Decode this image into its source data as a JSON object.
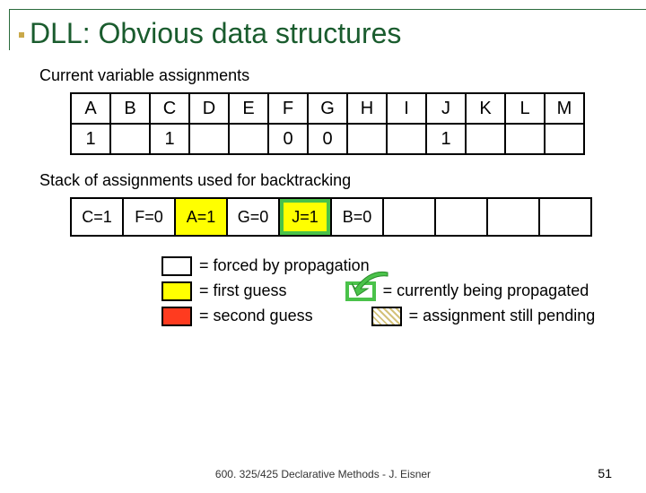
{
  "title": "DLL: Obvious data structures",
  "section1": "Current variable assignments",
  "vars": {
    "headers": [
      "A",
      "B",
      "C",
      "D",
      "E",
      "F",
      "G",
      "H",
      "I",
      "J",
      "K",
      "L",
      "M"
    ],
    "values": [
      "1",
      "",
      "1",
      "",
      "",
      "0",
      "0",
      "",
      "",
      "1",
      "",
      "",
      ""
    ]
  },
  "section2": "Stack of assignments used for backtracking",
  "stack": [
    "C=1",
    "F=0",
    "A=1",
    "G=0",
    "J=1",
    "B=0",
    "",
    "",
    "",
    ""
  ],
  "legend": {
    "forced": "= forced by propagation",
    "first": "= first guess",
    "second": "= second guess",
    "prop": "= currently being propagated",
    "pending": "= assignment still pending"
  },
  "footer": "600. 325/425 Declarative Methods - J. Eisner",
  "page": "51"
}
